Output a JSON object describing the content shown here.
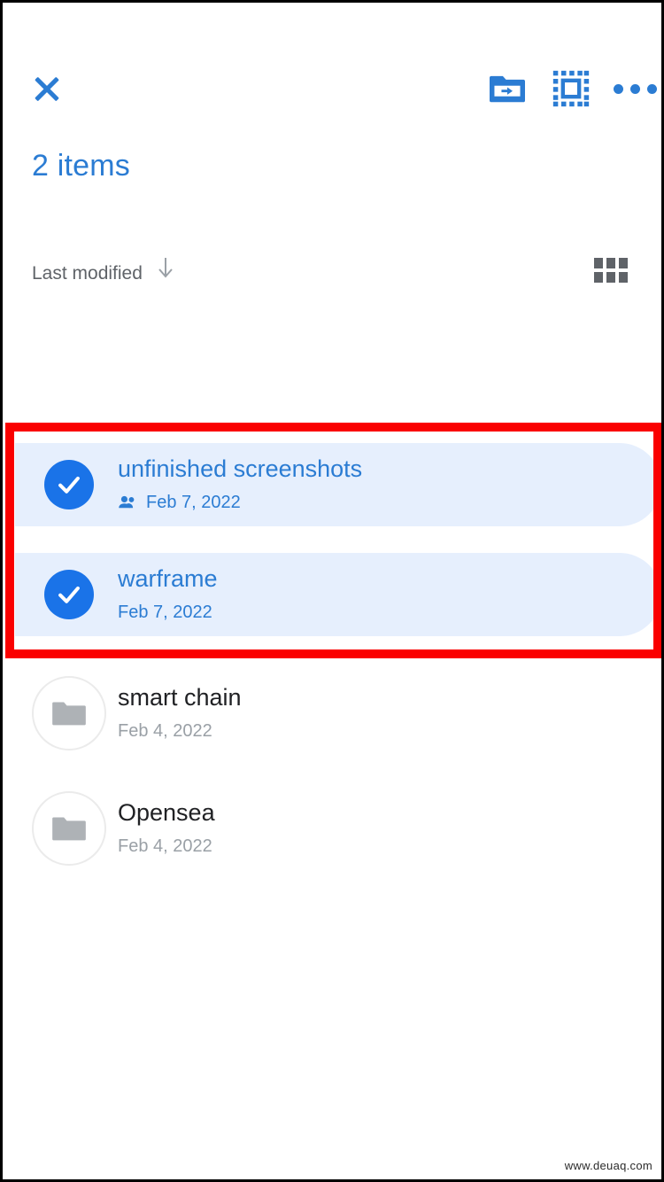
{
  "appbar": {
    "close_label": "close-icon",
    "actions": [
      {
        "name": "move-to-folder-icon",
        "label": "Move to folder"
      },
      {
        "name": "select-all-icon",
        "label": "Select all"
      },
      {
        "name": "more-options-icon",
        "label": "More options"
      }
    ]
  },
  "selection": {
    "count_text": "2 items"
  },
  "sort": {
    "label": "Last modified",
    "direction": "descending",
    "view_toggle": "grid-view"
  },
  "highlight": {
    "color": "#fa0000"
  },
  "colors": {
    "accent": "#2b7cd3",
    "check_blue": "#1a73e8",
    "selected_row_bg": "#e6effd",
    "muted_text": "#9aa0a6",
    "primary_text": "#202124"
  },
  "files": [
    {
      "name": "unfinished screenshots",
      "date": "Feb 7, 2022",
      "selected": true,
      "shared": true,
      "type": "folder"
    },
    {
      "name": "warframe",
      "date": "Feb 7, 2022",
      "selected": true,
      "shared": false,
      "type": "folder"
    },
    {
      "name": "smart chain",
      "date": "Feb 4, 2022",
      "selected": false,
      "shared": false,
      "type": "folder"
    },
    {
      "name": "Opensea",
      "date": "Feb 4, 2022",
      "selected": false,
      "shared": false,
      "type": "folder"
    }
  ],
  "watermark": {
    "text": "www.deuaq.com"
  }
}
